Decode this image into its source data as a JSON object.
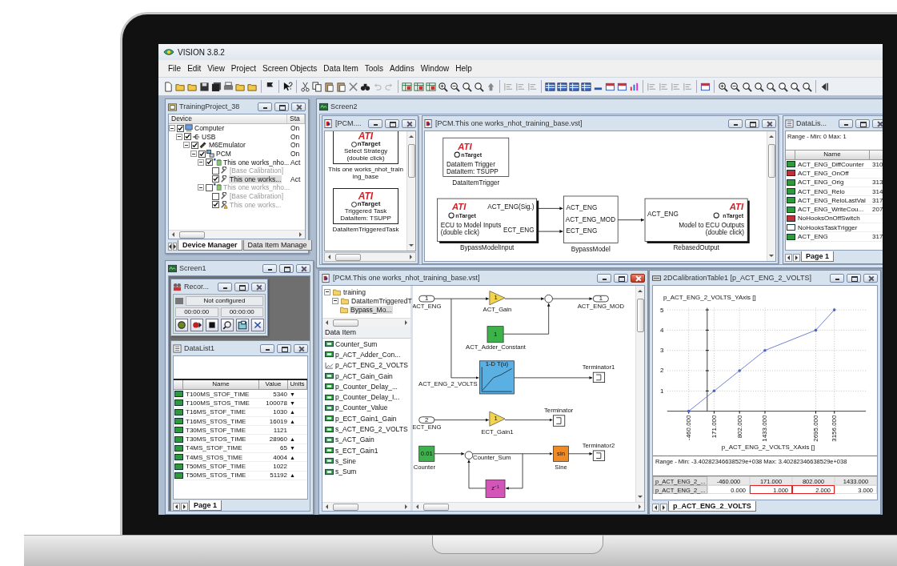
{
  "window": {
    "title": "VISION 3.8.2"
  },
  "menu": [
    {
      "label": "File"
    },
    {
      "label": "Edit"
    },
    {
      "label": "View"
    },
    {
      "label": "Project"
    },
    {
      "label": "Screen Objects"
    },
    {
      "label": "Data Item"
    },
    {
      "label": "Tools"
    },
    {
      "label": "Addins"
    },
    {
      "label": "Window"
    },
    {
      "label": "Help"
    }
  ],
  "project_window": {
    "title": "TrainingProject_38",
    "columns": [
      "Device",
      "Sta"
    ],
    "tree": [
      {
        "label": "Computer",
        "status": "On",
        "kind": "computer",
        "checked": true,
        "selected": false,
        "disabled": false,
        "children": [
          {
            "label": "USB",
            "status": "On",
            "kind": "usb",
            "checked": true,
            "selected": false,
            "disabled": false,
            "children": [
              {
                "label": "M6Emulator",
                "status": "On",
                "kind": "emulator",
                "checked": true,
                "selected": false,
                "disabled": false,
                "children": [
                  {
                    "label": "PCM",
                    "status": "On",
                    "kind": "ecu",
                    "checked": true,
                    "selected": false,
                    "disabled": false,
                    "children": [
                      {
                        "label": "This one works_nho...",
                        "status": "Act",
                        "kind": "strategy",
                        "checked": true,
                        "selected": false,
                        "disabled": false,
                        "children": [
                          {
                            "label": "[Base Calibration]",
                            "kind": "calibration",
                            "checked": false,
                            "selected": false,
                            "disabled": true
                          },
                          {
                            "label": "This one works...",
                            "status": "Act",
                            "kind": "calibration",
                            "checked": true,
                            "selected": true,
                            "disabled": false
                          }
                        ]
                      },
                      {
                        "label": "This one works_nho...",
                        "kind": "strategy",
                        "checked": false,
                        "selected": false,
                        "disabled": true,
                        "children": [
                          {
                            "label": "[Base Calibration]",
                            "kind": "calibration",
                            "checked": false,
                            "selected": false,
                            "disabled": true
                          },
                          {
                            "label": "This one works...",
                            "kind": "calibration-warning",
                            "checked": true,
                            "selected": false,
                            "disabled": true
                          }
                        ]
                      }
                    ]
                  }
                ]
              }
            ]
          }
        ]
      }
    ],
    "tabs": [
      {
        "label": "Device Manager",
        "selected": true
      },
      {
        "label": "Data Item Manage",
        "selected": false
      }
    ]
  },
  "screen1": {
    "title": "Screen1",
    "recorder": {
      "title": "Recor...",
      "status": "Not configured",
      "times": [
        "00:00:00",
        "00:00:00"
      ]
    },
    "datalist": {
      "title": "DataList1",
      "columns": [
        "Name",
        "Value",
        "Units"
      ],
      "rows": [
        {
          "name": "T100MS_STOF_TIME",
          "value": "5340",
          "trend": "▼"
        },
        {
          "name": "T100MS_STOS_TIME",
          "value": "100078",
          "trend": "▼"
        },
        {
          "name": "T16MS_STOF_TIME",
          "value": "1030",
          "trend": "▲"
        },
        {
          "name": "T16MS_STOS_TIME",
          "value": "16019",
          "trend": "▲"
        },
        {
          "name": "T30MS_STOF_TIME",
          "value": "1121"
        },
        {
          "name": "T30MS_STOS_TIME",
          "value": "28960",
          "trend": "▲"
        },
        {
          "name": "T4MS_STOF_TIME",
          "value": "65",
          "trend": "▼"
        },
        {
          "name": "T4MS_STOS_TIME",
          "value": "4004",
          "trend": "▲"
        },
        {
          "name": "T50MS_STOF_TIME",
          "value": "1022"
        },
        {
          "name": "T50MS_STOS_TIME",
          "value": "51192",
          "trend": "▲"
        }
      ],
      "tabs": [
        {
          "label": "Page 1",
          "selected": true
        }
      ]
    }
  },
  "screen2": {
    "title": "Screen2",
    "strategy_window": {
      "title": "[PCM....",
      "blocks": [
        {
          "logo": [
            "ATI",
            "nTarget"
          ],
          "lines": [
            "Select Strategy",
            "(double click)"
          ],
          "caption": "This one works_nhot_training_base"
        },
        {
          "logo": [
            "ATI",
            "nTarget"
          ],
          "lines": [
            "Triggered Task",
            "DataItem: TSUPP"
          ],
          "caption": "DataItemTriggeredTask"
        }
      ]
    },
    "model_window": {
      "title": "[PCM.This one works_nhot_training_base.vst]",
      "blocks": [
        {
          "kind": "ati",
          "logo": [
            "ATI",
            "nTarget"
          ],
          "lines": [
            "DataItem Trigger",
            "DataItem: TSUPP"
          ],
          "caption": "DataItemTrigger"
        },
        {
          "kind": "ati",
          "logo": [
            "ATI",
            "nTarget"
          ],
          "lines": [
            "ECU to Model Inputs",
            "(double click)"
          ],
          "ports_out": [
            "ACT_ENG(Sig.)",
            "ECT_ENG"
          ],
          "caption": "BypassModelInput"
        },
        {
          "kind": "subsystem",
          "ports_in": [
            "ACT_ENG",
            "ECT_ENG"
          ],
          "ports_out": [
            "ACT_ENG_MOD"
          ],
          "caption": "BypassModel"
        },
        {
          "kind": "ati",
          "logo": [
            "ATI",
            "nTarget"
          ],
          "lines": [
            "Model to ECU Outputs",
            "(double click)"
          ],
          "ports_in": [
            "ACT_ENG"
          ],
          "caption": "RebasedOutput"
        }
      ]
    },
    "datalist": {
      "title": "DataLis...",
      "range": "Range -  Min: 0   Max: 1",
      "columns": [
        "Name"
      ],
      "rows": [
        {
          "name": "ACT_ENG_DiffCounter",
          "value": "310",
          "kind": "numeric"
        },
        {
          "name": "ACT_ENG_OnOff",
          "kind": "switch"
        },
        {
          "name": "ACT_ENG_Orig",
          "value": "313",
          "kind": "numeric"
        },
        {
          "name": "ACT_ENG_Relo",
          "value": "314",
          "kind": "numeric"
        },
        {
          "name": "ACT_ENG_ReloLastVal",
          "value": "317",
          "kind": "numeric"
        },
        {
          "name": "ACT_ENG_WriteCou...",
          "value": "207",
          "kind": "numeric"
        },
        {
          "name": "NoHooksOnOffSwitch",
          "kind": "switch"
        },
        {
          "name": "NoHooksTaskTrigger",
          "kind": "trigger"
        },
        {
          "name": "ACT_ENG",
          "value": "317",
          "kind": "numeric"
        }
      ],
      "tabs": [
        {
          "label": "Page 1",
          "selected": true
        }
      ]
    }
  },
  "model_editor": {
    "title": "[PCM.This one works_nhot_training_base.vst]",
    "active": true,
    "tree": [
      {
        "label": "training",
        "selected": false,
        "children": [
          {
            "label": "DataItemTriggeredT",
            "selected": false,
            "children": [
              {
                "label": "Bypass_Mo...",
                "selected": true
              }
            ]
          }
        ]
      }
    ],
    "data_item_heading": "Data Item",
    "data_items": [
      {
        "label": "Counter_Sum",
        "kind": "scalar"
      },
      {
        "label": "p_ACT_Adder_Con...",
        "kind": "scalar"
      },
      {
        "label": "p_ACT_ENG_2_VOLTS",
        "kind": "table"
      },
      {
        "label": "p_ACT_Gain_Gain",
        "kind": "scalar"
      },
      {
        "label": "p_Counter_Delay_...",
        "kind": "scalar"
      },
      {
        "label": "p_Counter_Delay_I...",
        "kind": "scalar"
      },
      {
        "label": "p_Counter_Value",
        "kind": "scalar"
      },
      {
        "label": "p_ECT_Gain1_Gain",
        "kind": "scalar"
      },
      {
        "label": "s_ACT_ENG_2_VOLTS",
        "kind": "scalar"
      },
      {
        "label": "s_ACT_Gain",
        "kind": "scalar"
      },
      {
        "label": "s_ECT_Gain1",
        "kind": "scalar"
      },
      {
        "label": "s_Sine",
        "kind": "scalar"
      },
      {
        "label": "s_Sum",
        "kind": "scalar"
      }
    ],
    "blocks": [
      {
        "kind": "inport",
        "text": "1",
        "caption": "ACT_ENG"
      },
      {
        "kind": "gain",
        "text": "1",
        "caption": "ACT_Gain"
      },
      {
        "kind": "sum"
      },
      {
        "kind": "outport",
        "text": "1",
        "caption": "ACT_ENG_MOD"
      },
      {
        "kind": "constant",
        "text": "1",
        "caption": "ACT_Adder_Constant"
      },
      {
        "kind": "lookup",
        "text": "1-D T(u)",
        "caption": "ACT_ENG_2_VOLTS"
      },
      {
        "kind": "terminator",
        "caption": "Terminator1"
      },
      {
        "kind": "inport",
        "text": "2",
        "caption": "ECT_ENG"
      },
      {
        "kind": "gain",
        "text": "1",
        "caption": "ECT_Gain1"
      },
      {
        "kind": "terminator",
        "caption": "Terminator"
      },
      {
        "kind": "constant",
        "text": "0.01",
        "caption": "Counter"
      },
      {
        "kind": "sum",
        "caption": "Counter_Sum"
      },
      {
        "kind": "sine",
        "text": "sin",
        "caption": "Sine"
      },
      {
        "kind": "terminator",
        "caption": "Terminator2"
      },
      {
        "kind": "delay",
        "text": "z⁻¹"
      }
    ]
  },
  "calibration": {
    "title": "2DCalibrationTable1 [p_ACT_ENG_2_VOLTS]",
    "chart_data": {
      "type": "line",
      "xlabel": "p_ACT_ENG_2_VOLTS_XAxis []",
      "ylabel": "p_ACT_ENG_2_VOLTS_YAxis []",
      "x": [
        -460,
        171,
        802,
        1433,
        2695,
        3156
      ],
      "series": [
        {
          "color": "#4a62c8",
          "values": [
            0,
            1,
            2,
            3,
            4,
            5
          ]
        }
      ],
      "xlim": [
        -992,
        3938
      ],
      "ylim": [
        0,
        5.1
      ],
      "xticks": [
        {
          "value": -460,
          "label": "-460.000"
        },
        {
          "value": 171,
          "label": "171.000"
        },
        {
          "value": 802,
          "label": "802.000"
        },
        {
          "value": 1433,
          "label": "1433.000"
        },
        {
          "value": 2695,
          "label": "2695.000"
        },
        {
          "value": 3156,
          "label": "3156.000"
        }
      ],
      "yticks": [
        1,
        2,
        3,
        4,
        5
      ],
      "grid": true
    },
    "range": "Range -  Min: -3.40282346638529e+038   Max: 3.40282346638529e+038",
    "table": {
      "rows": [
        {
          "label": "p_ACT_ENG_2_...",
          "cells": [
            {
              "text": "-460.000",
              "selected": false
            },
            {
              "text": "171.000",
              "selected": false
            },
            {
              "text": "802.000",
              "selected": false
            },
            {
              "text": "1433.000",
              "selected": false
            }
          ]
        },
        {
          "label": "p_ACT_ENG_2_...",
          "cells": [
            {
              "text": "0.000",
              "selected": false
            },
            {
              "text": "1.000",
              "selected": true
            },
            {
              "text": "2.000",
              "selected": true
            },
            {
              "text": "3.000",
              "selected": false
            }
          ]
        }
      ]
    },
    "tabs": [
      {
        "label": "p_ACT_ENG_2_VOLTS",
        "selected": true
      }
    ]
  }
}
